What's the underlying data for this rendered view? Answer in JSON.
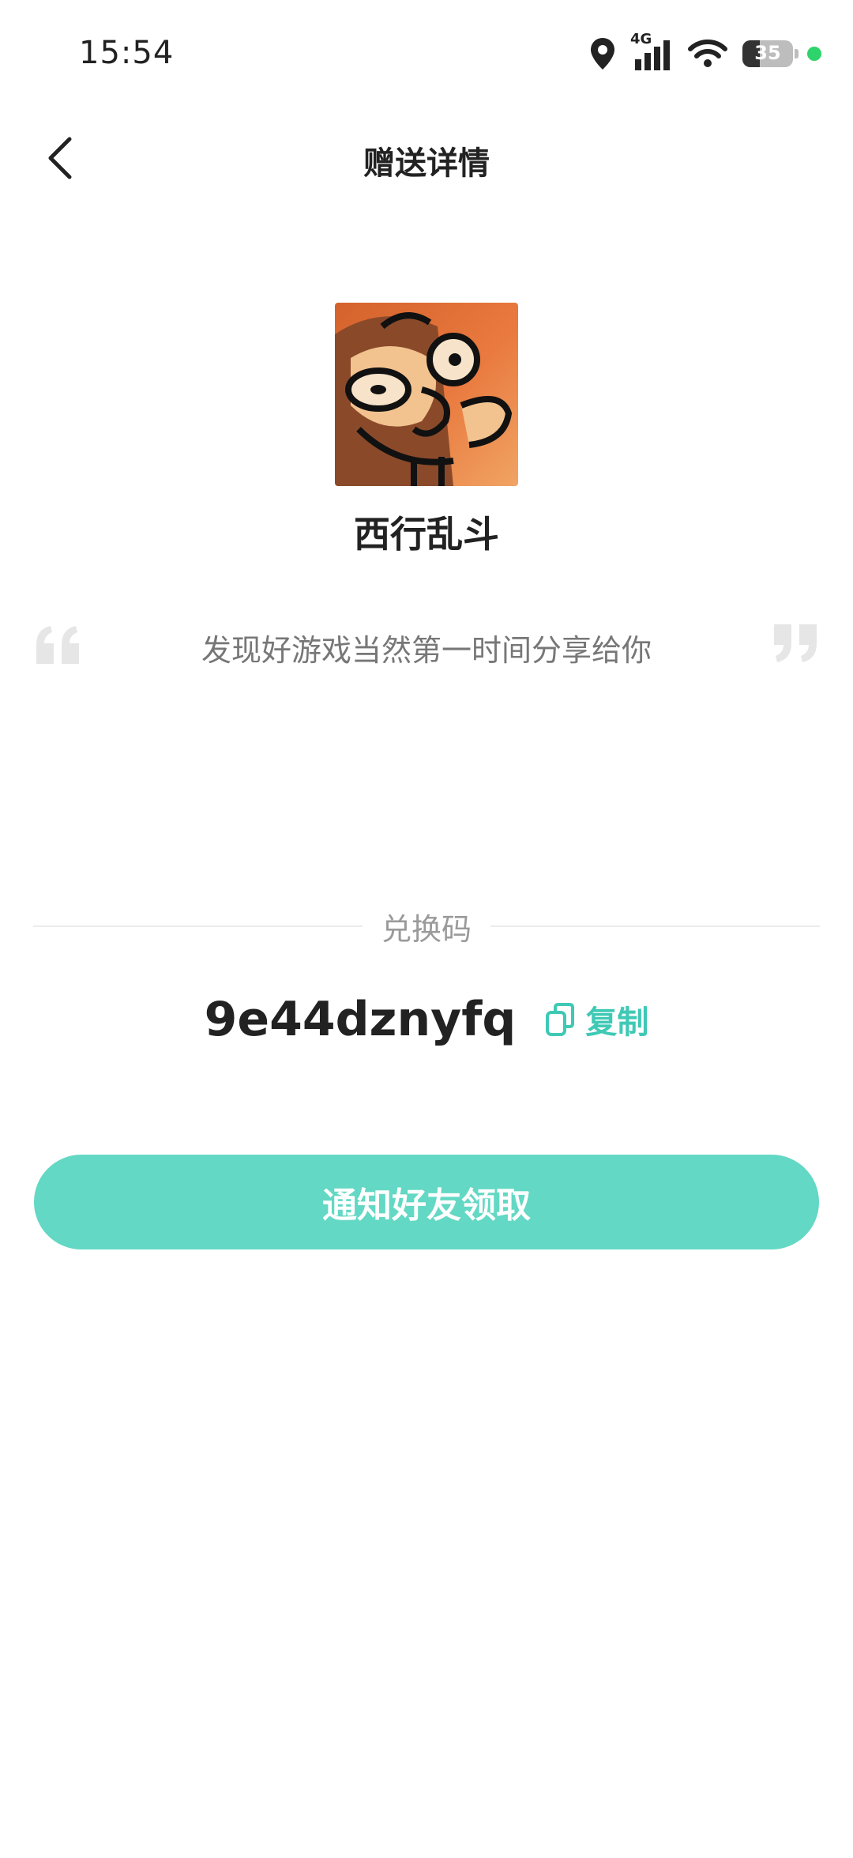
{
  "status_bar": {
    "time": "15:54",
    "network": "4G",
    "battery": "35",
    "icons": [
      "location-icon",
      "signal-icon",
      "wifi-icon",
      "battery-icon",
      "indicator-dot"
    ]
  },
  "header": {
    "title": "赠送详情",
    "back_icon": "chevron-left-icon"
  },
  "game": {
    "name": "西行乱斗"
  },
  "message": {
    "text": "发现好游戏当然第一时间分享给你"
  },
  "redeem": {
    "label": "兑换码",
    "code": "9e44dznyfq",
    "copy_label": "复制"
  },
  "actions": {
    "notify_label": "通知好友领取"
  },
  "colors": {
    "accent": "#63d8c4",
    "copy_text": "#3fc9b5",
    "status_dot": "#2fd36b"
  }
}
